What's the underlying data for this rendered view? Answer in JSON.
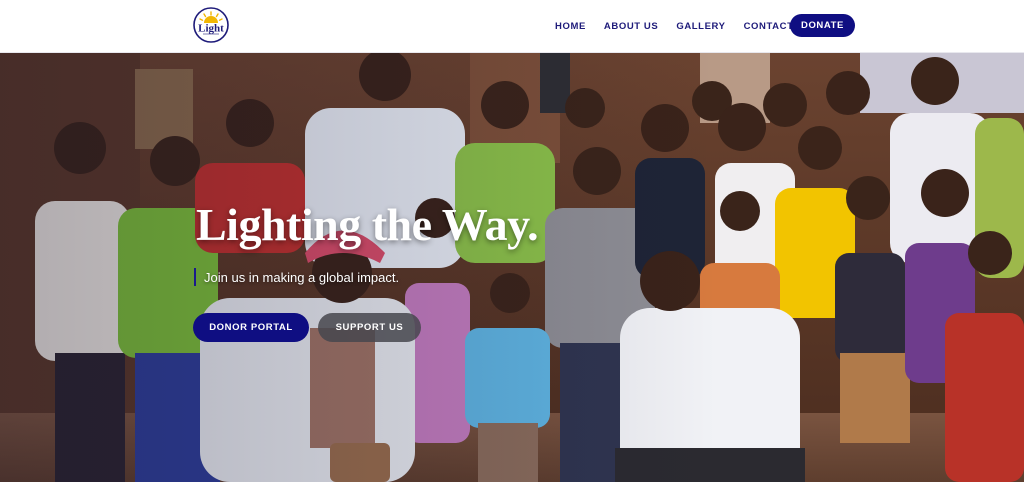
{
  "brand": {
    "logo_text": "Light",
    "logo_icon": "sun-rays-logo",
    "primary_color": "#0f0e82",
    "accent_color": "#f2b705"
  },
  "nav": {
    "items": [
      {
        "label": "HOME"
      },
      {
        "label": "ABOUT US"
      },
      {
        "label": "GALLERY"
      },
      {
        "label": "CONTACT"
      }
    ],
    "donate_label": "DONATE"
  },
  "hero": {
    "title": "Lighting the Way.",
    "subtitle": "Join us in making a global impact.",
    "buttons": {
      "donor_portal": "DONOR PORTAL",
      "support_us": "SUPPORT US"
    },
    "photo_description_icon": "group-photo-children"
  }
}
